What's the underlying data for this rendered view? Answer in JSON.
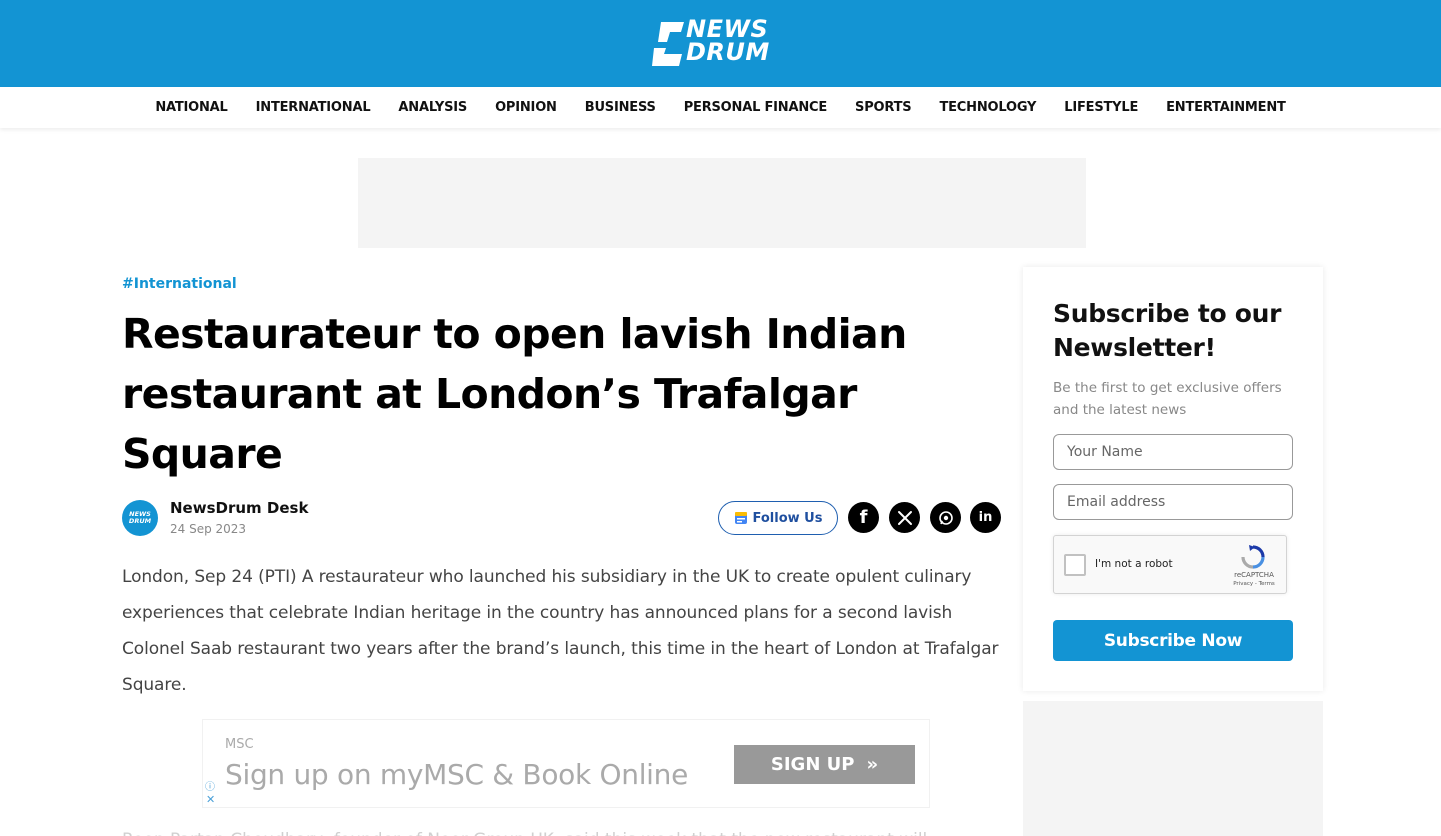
{
  "brand": {
    "line1": "NEWS",
    "line2": "DRUM",
    "accent_color": "#1394d3"
  },
  "nav": {
    "items": [
      "NATIONAL",
      "INTERNATIONAL",
      "ANALYSIS",
      "OPINION",
      "BUSINESS",
      "PERSONAL FINANCE",
      "SPORTS",
      "TECHNOLOGY",
      "LIFESTYLE",
      "ENTERTAINMENT"
    ]
  },
  "article": {
    "category": "#International",
    "headline": "Restaurateur to open lavish Indian restaurant at London’s Trafalgar Square",
    "author": "NewsDrum Desk",
    "author_avatar_text": "NEWS DRUM",
    "date": "24 Sep 2023",
    "follow_label": "Follow Us",
    "share_icons": [
      "facebook-icon",
      "x-icon",
      "whatsapp-icon",
      "linkedin-icon"
    ],
    "paragraph_1": "London, Sep 24 (PTI) A restaurateur who launched his subsidiary in the UK to create opulent culinary experiences that celebrate Indian heritage in the country has announced plans for a second lavish Colonel Saab restaurant two years after the brand’s launch, this time in the heart of London at Trafalgar Square.",
    "paragraph_2": "Roop Partap Choudhary, founder of Noor Group UK, said this week that the new restaurant will"
  },
  "inline_ad": {
    "brand": "MSC",
    "copy": "Sign up on myMSC & Book Online",
    "cta": "SIGN UP",
    "cta_glyph": "»",
    "info_glyph": "ⓘ",
    "close_glyph": "✕"
  },
  "newsletter": {
    "title": "Subscribe to our Newsletter!",
    "subtitle": "Be the first to get exclusive offers and the latest news",
    "name_placeholder": "Your Name",
    "email_placeholder": "Email address",
    "captcha_label": "I'm not a robot",
    "captcha_brand": "reCAPTCHA",
    "captcha_terms": "Privacy - Terms",
    "submit_label": "Subscribe Now"
  }
}
